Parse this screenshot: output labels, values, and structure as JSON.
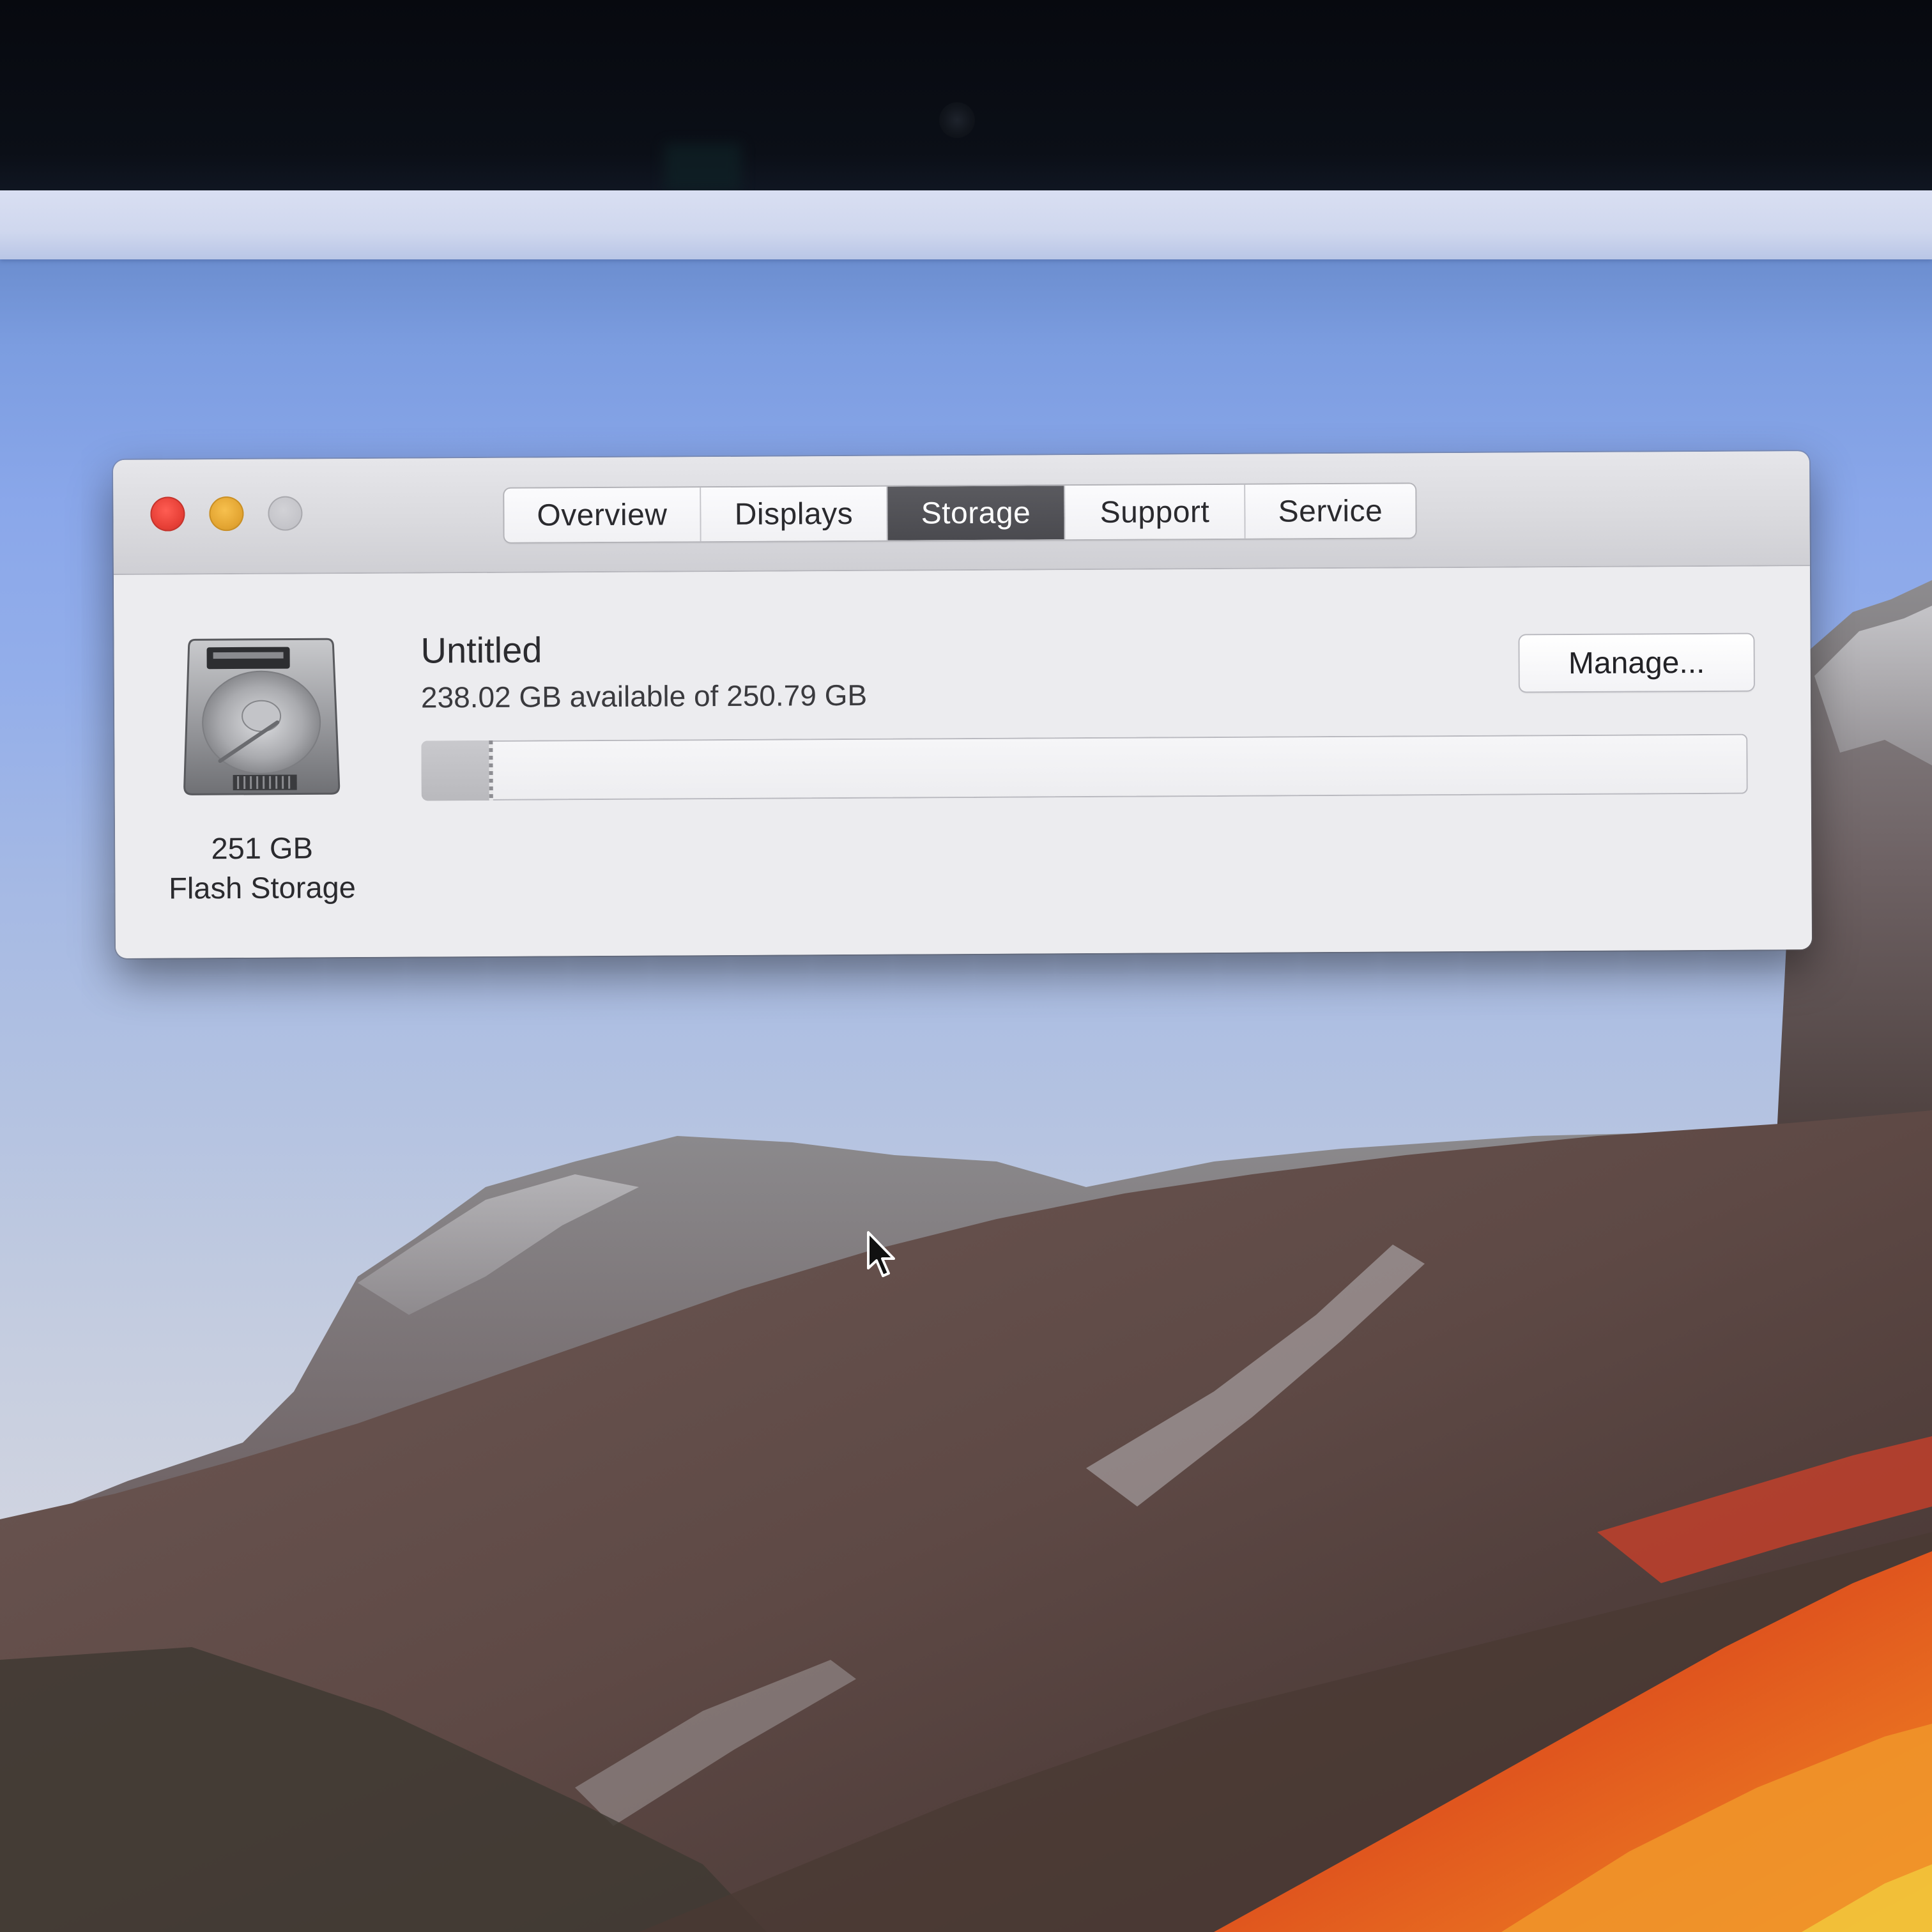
{
  "window": {
    "tabs": [
      {
        "label": "Overview",
        "active": false
      },
      {
        "label": "Displays",
        "active": false
      },
      {
        "label": "Storage",
        "active": true
      },
      {
        "label": "Support",
        "active": false
      },
      {
        "label": "Service",
        "active": false
      }
    ],
    "traffic_lights": {
      "close_color": "#e63f36",
      "minimize_color": "#e3a532",
      "zoom_color": "#c3c3c8"
    }
  },
  "storage": {
    "disk_icon": "hard-drive-icon",
    "disk_capacity": "251 GB",
    "disk_type": "Flash Storage",
    "volume_name": "Untitled",
    "availability_text": "238.02 GB available of 250.79 GB",
    "available_gb": 238.02,
    "total_gb": 250.79,
    "used_fraction": 0.0509,
    "manage_label": "Manage..."
  },
  "colors": {
    "active_tab_bg": "#4f4f54",
    "window_bg": "#ececef"
  },
  "pointer": {
    "icon": "arrow-cursor-icon"
  }
}
